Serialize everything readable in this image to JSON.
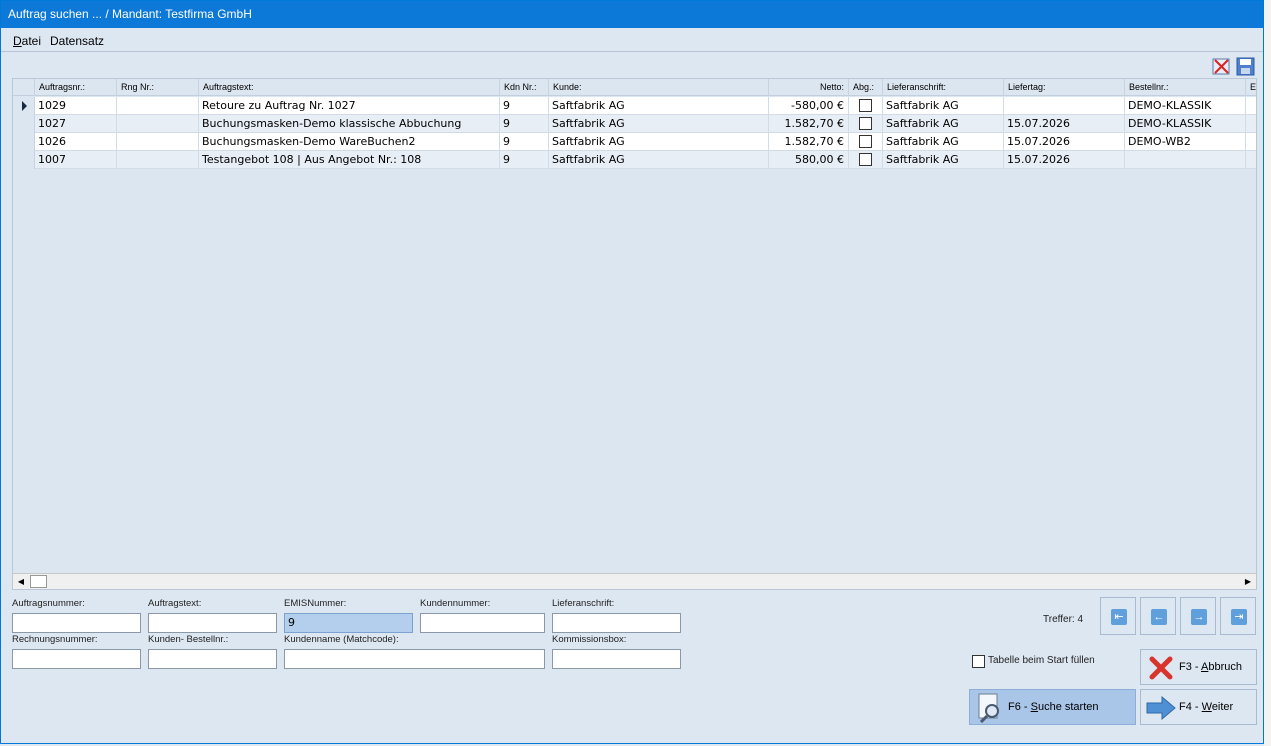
{
  "window": {
    "title": "Auftrag suchen ... / Mandant: Testfirma GmbH"
  },
  "menu": [
    {
      "label": "Datei",
      "underline": "D"
    },
    {
      "label": "Datensatz",
      "underline": ""
    }
  ],
  "toolbar": {
    "icons": [
      "delete-icon",
      "save-icon"
    ]
  },
  "grid": {
    "columns": [
      "",
      "Auftragsnr.:",
      "Rng Nr.:",
      "Auftragstext:",
      "Kdn Nr.:",
      "Kunde:",
      "Netto:",
      "Abg.:",
      "Lieferanschrift:",
      "Liefertag:",
      "Bestellnr.:",
      "E"
    ],
    "rows": [
      {
        "auftragsnr": "1029",
        "rngnr": "",
        "text": "Retoure zu Auftrag Nr. 1027",
        "kdnnr": "9",
        "kunde": "Saftfabrik AG",
        "netto": "-580,00 €",
        "abg": false,
        "lieferanschrift": "Saftfabrik AG",
        "liefertag": "",
        "bestellnr": "DEMO-KLASSIK"
      },
      {
        "auftragsnr": "1027",
        "rngnr": "",
        "text": "Buchungsmasken-Demo klassische Abbuchung",
        "kdnnr": "9",
        "kunde": "Saftfabrik AG",
        "netto": "1.582,70 €",
        "abg": false,
        "lieferanschrift": "Saftfabrik AG",
        "liefertag": "15.07.2026",
        "bestellnr": "DEMO-KLASSIK"
      },
      {
        "auftragsnr": "1026",
        "rngnr": "",
        "text": "Buchungsmasken-Demo WareBuchen2",
        "kdnnr": "9",
        "kunde": "Saftfabrik AG",
        "netto": "1.582,70 €",
        "abg": false,
        "lieferanschrift": "Saftfabrik AG",
        "liefertag": "15.07.2026",
        "bestellnr": "DEMO-WB2"
      },
      {
        "auftragsnr": "1007",
        "rngnr": "",
        "text": "Testangebot 108 | Aus Angebot Nr.: 108",
        "kdnnr": "9",
        "kunde": "Saftfabrik AG",
        "netto": "580,00 €",
        "abg": false,
        "lieferanschrift": "Saftfabrik AG",
        "liefertag": "15.07.2026",
        "bestellnr": ""
      }
    ]
  },
  "filters": {
    "auftragsnummer": {
      "label": "Auftragsnummer:",
      "value": ""
    },
    "auftragstext": {
      "label": "Auftragstext:",
      "value": ""
    },
    "emisnummer": {
      "label": "EMISNummer:",
      "value": "9"
    },
    "kundennummer": {
      "label": "Kundennummer:",
      "value": ""
    },
    "lieferanschrift": {
      "label": "Lieferanschrift:",
      "value": ""
    },
    "rechnungsnummer": {
      "label": "Rechnungsnummer:",
      "value": ""
    },
    "kundenbestellnr": {
      "label": "Kunden- Bestellnr.:",
      "value": ""
    },
    "kundenname": {
      "label": "Kundenname (Matchcode):",
      "value": ""
    },
    "kommissionsbox": {
      "label": "Kommissionsbox:",
      "value": ""
    }
  },
  "nav": {
    "treffer": "Treffer: 4",
    "icons": [
      "first-record-icon",
      "previous-record-icon",
      "next-record-icon",
      "last-record-icon"
    ]
  },
  "options": {
    "tabelle_start_label": "Tabelle beim Start füllen",
    "tabelle_start_checked": false
  },
  "buttons": {
    "abbruch": {
      "prefix": "F3 - ",
      "accel": "A",
      "rest": "bbruch"
    },
    "suche": {
      "prefix": "F6 - ",
      "accel": "S",
      "rest": "uche starten"
    },
    "weiter": {
      "prefix": "F4 - ",
      "accel": "W",
      "rest": "eiter"
    }
  },
  "colors": {
    "titlebar": "#0c78d8",
    "window_bg": "#dde7f2",
    "active_input": "#b4cfee",
    "primary_button": "#a9c6e8"
  }
}
